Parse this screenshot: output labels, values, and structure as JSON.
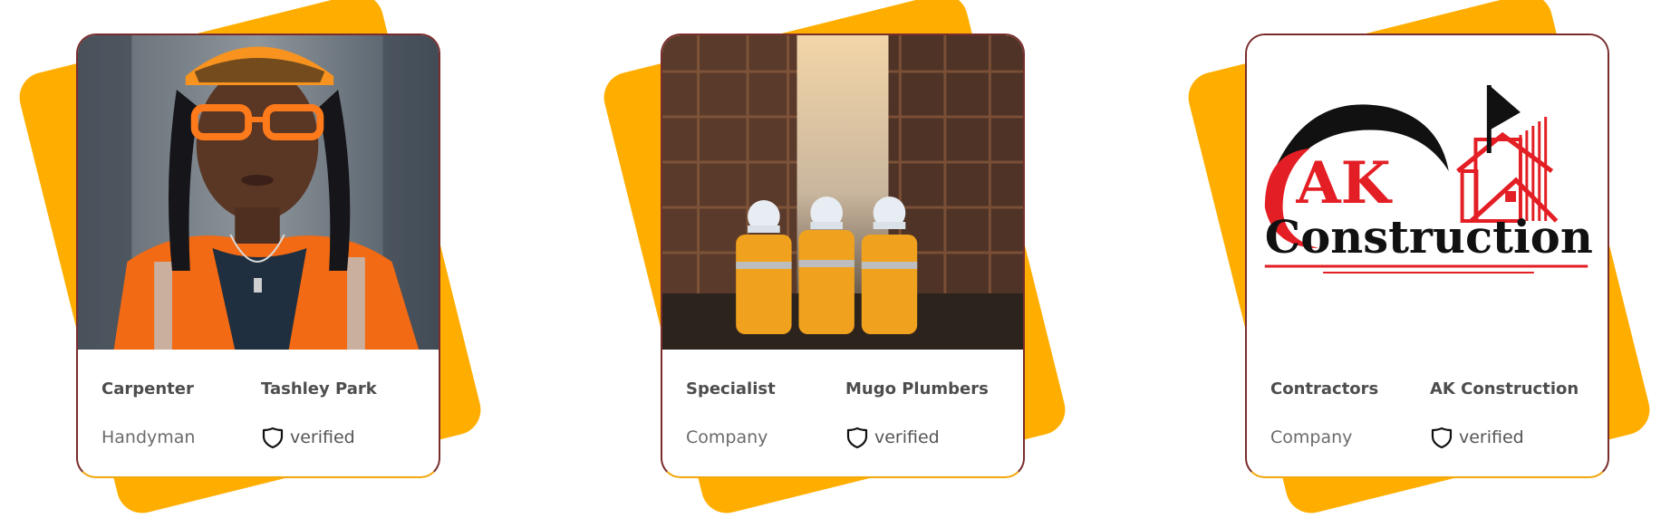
{
  "cards": [
    {
      "role": "Carpenter",
      "name": "Tashley Park",
      "type": "Handyman",
      "badge": "verified",
      "image": "portrait-photo"
    },
    {
      "role": "Specialist",
      "name": "Mugo Plumbers",
      "type": "Company",
      "badge": "verified",
      "image": "construction-site-photo"
    },
    {
      "role": "Contractors",
      "name": "AK Construction",
      "type": "Company",
      "badge": "verified",
      "image": "company-logo"
    }
  ],
  "logo": {
    "line1": "AK",
    "line2": "Construction"
  },
  "colors": {
    "accent": "#FFAE00",
    "border": "#F2A80E",
    "logo_red": "#E31E24",
    "logo_black": "#111111"
  },
  "icons": {
    "badge": "shield-icon"
  }
}
